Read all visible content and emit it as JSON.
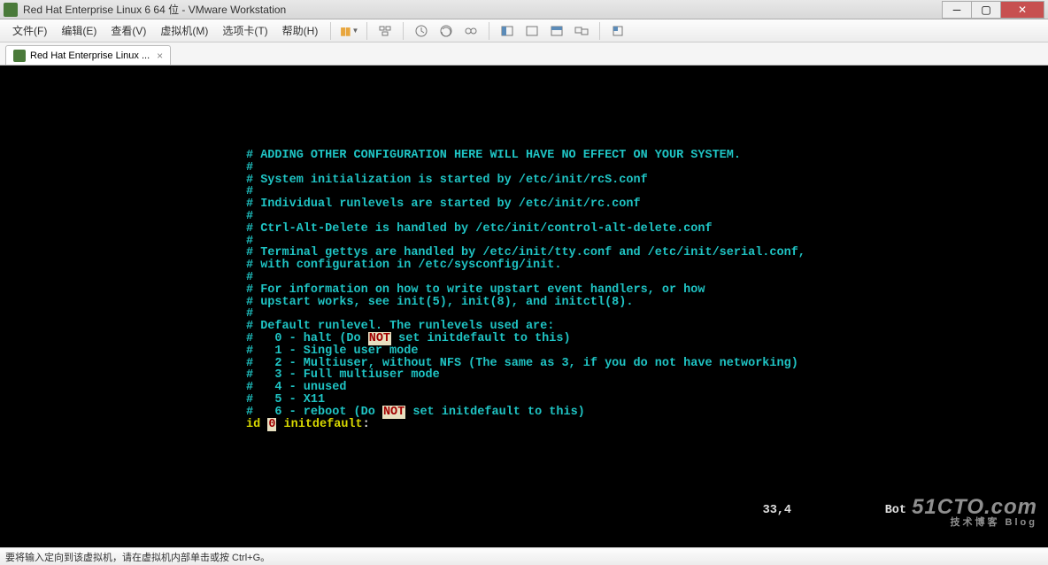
{
  "window": {
    "title": "Red Hat Enterprise Linux 6 64 位 - VMware Workstation"
  },
  "menu": {
    "file": "文件(F)",
    "edit": "编辑(E)",
    "view": "查看(V)",
    "vm": "虚拟机(M)",
    "tabs": "选项卡(T)",
    "help": "帮助(H)"
  },
  "tab": {
    "label": "Red Hat Enterprise Linux ..."
  },
  "terminal": {
    "lines": [
      {
        "type": "teal",
        "text": "# ADDING OTHER CONFIGURATION HERE WILL HAVE NO EFFECT ON YOUR SYSTEM."
      },
      {
        "type": "teal",
        "text": "#"
      },
      {
        "type": "teal",
        "text": "# System initialization is started by /etc/init/rcS.conf"
      },
      {
        "type": "teal",
        "text": "#"
      },
      {
        "type": "teal",
        "text": "# Individual runlevels are started by /etc/init/rc.conf"
      },
      {
        "type": "teal",
        "text": "#"
      },
      {
        "type": "teal",
        "text": "# Ctrl-Alt-Delete is handled by /etc/init/control-alt-delete.conf"
      },
      {
        "type": "teal",
        "text": "#"
      },
      {
        "type": "teal",
        "text": "# Terminal gettys are handled by /etc/init/tty.conf and /etc/init/serial.conf,"
      },
      {
        "type": "teal",
        "text": "# with configuration in /etc/sysconfig/init."
      },
      {
        "type": "teal",
        "text": "#"
      },
      {
        "type": "teal",
        "text": "# For information on how to write upstart event handlers, or how"
      },
      {
        "type": "teal",
        "text": "# upstart works, see init(5), init(8), and initctl(8)."
      },
      {
        "type": "teal",
        "text": "#"
      },
      {
        "type": "teal",
        "text": "# Default runlevel. The runlevels used are:"
      },
      {
        "type": "runlevel",
        "parts": [
          "#   0 - halt (Do ",
          "NOT",
          " set initdefault to this)"
        ]
      },
      {
        "type": "teal",
        "text": "#   1 - Single user mode"
      },
      {
        "type": "teal",
        "text": "#   2 - Multiuser, without NFS (The same as 3, if you do not have networking)"
      },
      {
        "type": "teal",
        "text": "#   3 - Full multiuser mode"
      },
      {
        "type": "teal",
        "text": "#   4 - unused"
      },
      {
        "type": "teal",
        "text": "#   5 - X11"
      },
      {
        "type": "runlevel",
        "parts": [
          "#   6 - reboot (Do ",
          "NOT",
          " set initdefault to this)"
        ]
      },
      {
        "type": "idline",
        "parts": [
          "id ",
          "0",
          " initdefault"
        ]
      }
    ],
    "status_pos": "33,4",
    "status_loc": "Bot"
  },
  "statusbar": {
    "text": "要将输入定向到该虚拟机，请在虚拟机内部单击或按 Ctrl+G。"
  },
  "watermark": {
    "main": "51CTO.com",
    "sub": "技术博客  Blog"
  }
}
